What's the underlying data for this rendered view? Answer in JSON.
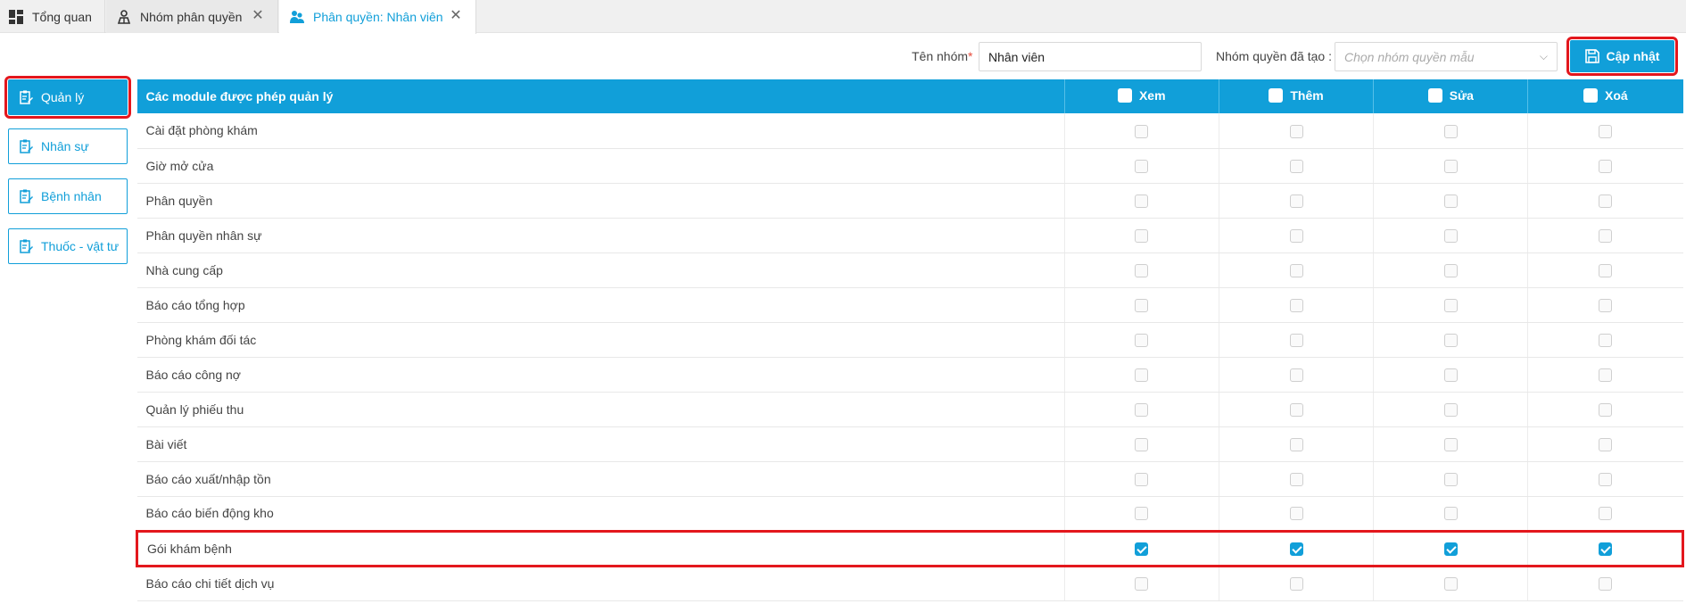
{
  "tabs": [
    {
      "label": "Tổng quan",
      "icon": "dashboard-icon",
      "closable": false
    },
    {
      "label": "Nhóm phân quyền",
      "icon": "user-group-icon",
      "closable": true
    },
    {
      "label": "Phân quyền: Nhân viên",
      "icon": "users-icon",
      "closable": true,
      "active": true
    }
  ],
  "header": {
    "group_name_label": "Tên nhóm",
    "group_name_required": "*",
    "group_name_value": "Nhân viên",
    "template_label": "Nhóm quyền đã tạo :",
    "template_placeholder": "Chọn nhóm quyền mẫu",
    "update_label": "Cập nhật"
  },
  "sidebar": {
    "items": [
      {
        "label": "Quản lý",
        "active": true
      },
      {
        "label": "Nhân sự",
        "active": false
      },
      {
        "label": "Bệnh nhân",
        "active": false
      },
      {
        "label": "Thuốc - vật tư",
        "active": false
      }
    ]
  },
  "table": {
    "headers": {
      "module": "Các module được phép quản lý",
      "view": "Xem",
      "add": "Thêm",
      "edit": "Sửa",
      "delete": "Xoá"
    },
    "rows": [
      {
        "name": "Cài đặt phòng khám",
        "view": false,
        "add": false,
        "edit": false,
        "delete": false
      },
      {
        "name": "Giờ mở cửa",
        "view": false,
        "add": false,
        "edit": false,
        "delete": false
      },
      {
        "name": "Phân quyền",
        "view": false,
        "add": false,
        "edit": false,
        "delete": false
      },
      {
        "name": "Phân quyền nhân sự",
        "view": false,
        "add": false,
        "edit": false,
        "delete": false
      },
      {
        "name": "Nhà cung cấp",
        "view": false,
        "add": false,
        "edit": false,
        "delete": false
      },
      {
        "name": "Báo cáo tổng hợp",
        "view": false,
        "add": false,
        "edit": false,
        "delete": false
      },
      {
        "name": "Phòng khám đối tác",
        "view": false,
        "add": false,
        "edit": false,
        "delete": false
      },
      {
        "name": "Báo cáo công nợ",
        "view": false,
        "add": false,
        "edit": false,
        "delete": false
      },
      {
        "name": "Quản lý phiếu thu",
        "view": false,
        "add": false,
        "edit": false,
        "delete": false
      },
      {
        "name": "Bài viết",
        "view": false,
        "add": false,
        "edit": false,
        "delete": false
      },
      {
        "name": "Báo cáo xuất/nhập tồn",
        "view": false,
        "add": false,
        "edit": false,
        "delete": false
      },
      {
        "name": "Báo cáo biến động kho",
        "view": false,
        "add": false,
        "edit": false,
        "delete": false
      },
      {
        "name": "Gói khám bệnh",
        "view": true,
        "add": true,
        "edit": true,
        "delete": true,
        "highlighted": true
      },
      {
        "name": "Báo cáo chi tiết dịch vụ",
        "view": false,
        "add": false,
        "edit": false,
        "delete": false
      }
    ]
  },
  "colors": {
    "accent": "#119fd9",
    "highlight": "#e3171d"
  }
}
